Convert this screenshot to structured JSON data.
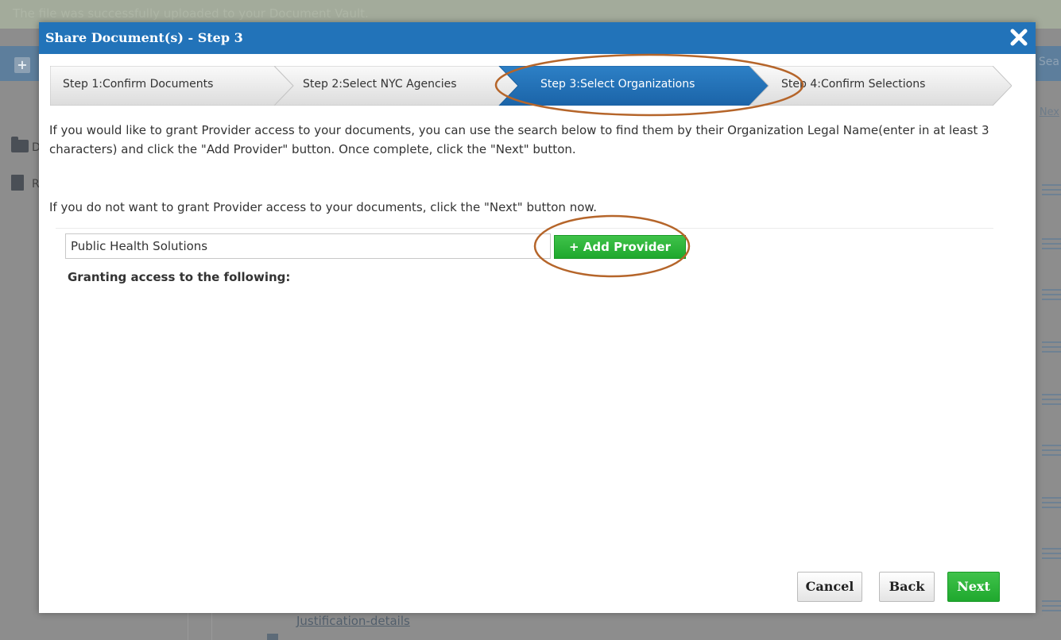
{
  "background": {
    "banner_text": "The file was successfully uploaded to your Document Vault.",
    "search_partial": "Sea",
    "next_partial": "Nex",
    "sidebar_letter_1": "D",
    "sidebar_letter_2": "R",
    "link_text": "Justification-details"
  },
  "modal": {
    "title": "Share Document(s)  - Step 3",
    "steps": [
      {
        "label": "Step 1:Confirm Documents",
        "active": false
      },
      {
        "label": "Step 2:Select NYC Agencies",
        "active": false
      },
      {
        "label": "Step 3:Select Organizations",
        "active": true
      },
      {
        "label": "Step 4:Confirm Selections",
        "active": false
      }
    ],
    "instructions": "If you would like to grant Provider access to your documents, you can use the search below to find them by their Organization Legal Name(enter in at least 3 characters) and click the \"Add Provider\" button. Once complete, click the \"Next\" button.",
    "instructions_skip": "If you do not want to grant Provider access to your documents, click the \"Next\" button now.",
    "provider_input_value": "Public Health Solutions",
    "add_provider_label": "+ Add Provider",
    "granting_label": "Granting access to the following:",
    "cancel_label": "Cancel",
    "back_label": "Back",
    "next_label": "Next"
  },
  "colors": {
    "header_blue": "#2273b9",
    "active_step": "#1f6fb5",
    "green_button": "#2eb83b",
    "annotation": "#b5652a"
  },
  "icons": {
    "close": "close-icon",
    "folder": "folder-icon",
    "trash": "trash-icon",
    "menu": "hamburger-icon"
  }
}
